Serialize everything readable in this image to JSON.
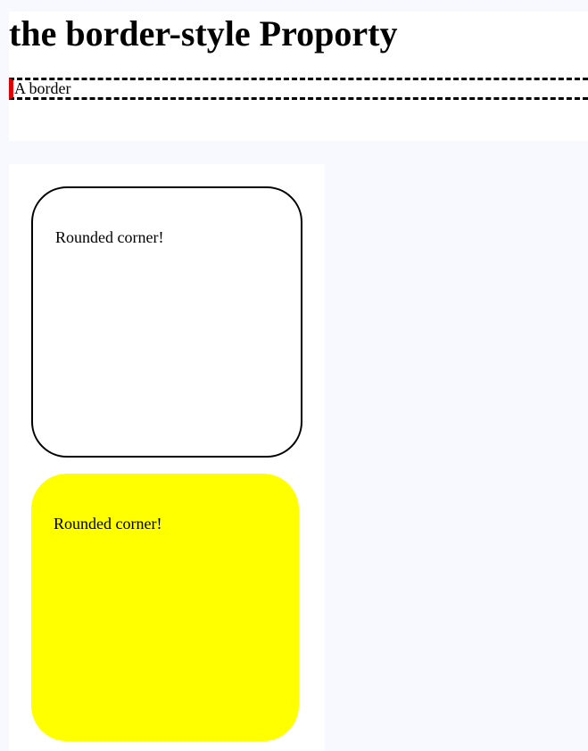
{
  "header": {
    "title": "the border-style Proporty"
  },
  "border_demo": {
    "text": "A border",
    "colors": {
      "dashed": "#000000",
      "left_accent": "#e00000"
    }
  },
  "cards": [
    {
      "text": "Rounded corner!",
      "style": "outlined",
      "background": "#ffffff"
    },
    {
      "text": "Rounded corner!",
      "style": "filled",
      "background": "#ffff00"
    }
  ],
  "page": {
    "background": "#f8f8ff"
  }
}
